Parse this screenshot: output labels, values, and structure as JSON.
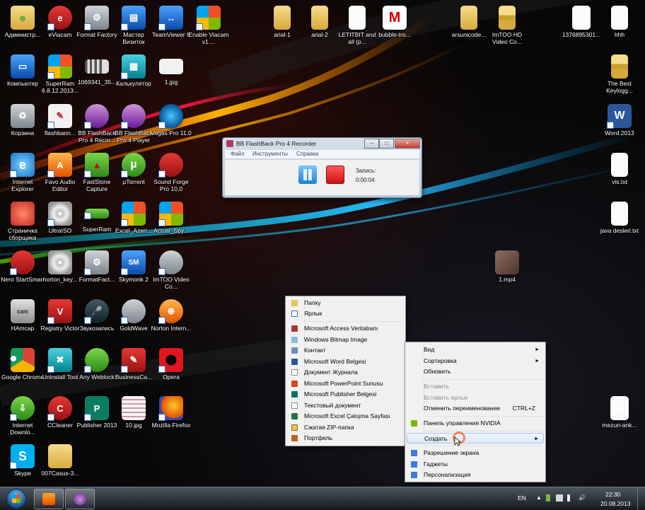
{
  "desktop": {
    "icons": [
      {
        "label": "Администр...",
        "icon": "user-folder-icon"
      },
      {
        "label": "eViacam",
        "icon": "eviacam-icon"
      },
      {
        "label": "Format Factory",
        "icon": "format-factory-icon"
      },
      {
        "label": "Мастер Визиток",
        "icon": "business-card-icon"
      },
      {
        "label": "TeamViewer 8",
        "icon": "teamviewer-icon"
      },
      {
        "label": "Enable Viacam v1....",
        "icon": "windows-installer-icon"
      },
      {
        "label": "arial-1",
        "icon": "folder-icon"
      },
      {
        "label": "arial-2",
        "icon": "folder-icon"
      },
      {
        "label": "LETITBIT and all (p...",
        "icon": "document-icon"
      },
      {
        "label": "bubble-tro...",
        "icon": "bubble-trouble-icon"
      },
      {
        "label": "arsunicode...",
        "icon": "folder-icon"
      },
      {
        "label": "ImTOO HD Video Co...",
        "icon": "archive-folder-icon"
      },
      {
        "label": "1376895301...",
        "icon": "word-document-icon"
      },
      {
        "label": "hhh",
        "icon": "document-icon"
      },
      {
        "label": "Компьютер",
        "icon": "computer-icon"
      },
      {
        "label": "SuperRam 6.8.12.2013...",
        "icon": "windows-installer-icon"
      },
      {
        "label": "1069341_35...",
        "icon": "image-icon"
      },
      {
        "label": "Калькулятор",
        "icon": "calculator-icon"
      },
      {
        "label": "1.jpg",
        "icon": "image-icon"
      },
      {
        "label": "The Best Keylogg...",
        "icon": "archive-folder-icon"
      },
      {
        "label": "Корзина",
        "icon": "recycle-bin-icon"
      },
      {
        "label": "flashbann...",
        "icon": "flash-banner-icon"
      },
      {
        "label": "BB FlashBack Pro 4 Recor...",
        "icon": "flashback-recorder-icon"
      },
      {
        "label": "BB FlashBack Pro 4 Player",
        "icon": "flashback-player-icon"
      },
      {
        "label": "Vegas Pro 11.0",
        "icon": "vegas-pro-icon"
      },
      {
        "label": "Word 2013",
        "icon": "word-icon"
      },
      {
        "label": "Internet Explorer",
        "icon": "internet-explorer-icon"
      },
      {
        "label": "Favo Audio Editor",
        "icon": "audio-editor-icon"
      },
      {
        "label": "FastStone Capture",
        "icon": "faststone-capture-icon"
      },
      {
        "label": "µTorrent",
        "icon": "utorrent-icon"
      },
      {
        "label": "Sound Forge Pro 10.0",
        "icon": "sound-forge-icon"
      },
      {
        "label": "vis.txt",
        "icon": "text-file-icon"
      },
      {
        "label": "Страничка сборщика",
        "icon": "collector-page-icon"
      },
      {
        "label": "UltraISO",
        "icon": "ultraiso-icon"
      },
      {
        "label": "SuperRam",
        "icon": "superram-icon"
      },
      {
        "label": "Excel_Azeri...",
        "icon": "windows-installer-icon"
      },
      {
        "label": "Actual_Spy...",
        "icon": "windows-installer-icon"
      },
      {
        "label": "java desleri.txt",
        "icon": "text-file-icon"
      },
      {
        "label": "Nero StartSmart",
        "icon": "nero-icon"
      },
      {
        "label": "norton_key...",
        "icon": "disc-icon"
      },
      {
        "label": "FormatFact...",
        "icon": "format-factory-icon"
      },
      {
        "label": "Skymonk 2",
        "icon": "skymonk-icon"
      },
      {
        "label": "ImTOO Video Co...",
        "icon": "film-reel-icon"
      },
      {
        "label": "1.mp4",
        "icon": "video-file-icon"
      },
      {
        "label": "HAmcap",
        "icon": "amcap-icon"
      },
      {
        "label": "Registry Victor",
        "icon": "registry-victor-icon"
      },
      {
        "label": "Звукозапись",
        "icon": "microphone-icon"
      },
      {
        "label": "GoldWave",
        "icon": "goldwave-icon"
      },
      {
        "label": "Norton Intern...",
        "icon": "norton-icon"
      },
      {
        "label": "Google Chrome",
        "icon": "chrome-icon"
      },
      {
        "label": "Uninstall Tool",
        "icon": "uninstall-tool-icon"
      },
      {
        "label": "Any Weblock",
        "icon": "any-weblock-icon"
      },
      {
        "label": "BusinessCa...",
        "icon": "business-card-icon"
      },
      {
        "label": "Opera",
        "icon": "opera-icon"
      },
      {
        "label": "Internet Downlo...",
        "icon": "internet-download-manager-icon"
      },
      {
        "label": "CCleaner",
        "icon": "ccleaner-icon"
      },
      {
        "label": "Publisher 2013",
        "icon": "publisher-icon"
      },
      {
        "label": "10.jpg",
        "icon": "image-icon"
      },
      {
        "label": "Mozilla Firefox",
        "icon": "firefox-icon"
      },
      {
        "label": "mezun-ank...",
        "icon": "word-document-icon"
      },
      {
        "label": "Skype",
        "icon": "skype-icon"
      },
      {
        "label": "007Casus-3...",
        "icon": "folder-icon"
      }
    ]
  },
  "recorder": {
    "title": "BB FlashBack Pro 4 Recorder",
    "menu": [
      "Файл",
      "Инструменты",
      "Справка"
    ],
    "record_label": "Запись:",
    "record_time": "0:00:04",
    "minimize": "–",
    "maximize": "□",
    "close": "×"
  },
  "create_submenu": {
    "items": [
      {
        "label": "Папку",
        "icon": "folder-icon"
      },
      {
        "label": "Ярлык",
        "icon": "shortcut-icon"
      },
      {
        "label": "Microsoft Access Veritabanı",
        "icon": "access-icon"
      },
      {
        "label": "Windows Bitmap Image",
        "icon": "bitmap-icon"
      },
      {
        "label": "Контакт",
        "icon": "contact-icon"
      },
      {
        "label": "Microsoft Word Belgesi",
        "icon": "word-icon"
      },
      {
        "label": "Документ Журнала",
        "icon": "journal-icon"
      },
      {
        "label": "Microsoft PowerPoint Sunusu",
        "icon": "powerpoint-icon"
      },
      {
        "label": "Microsoft Publisher Belgesi",
        "icon": "publisher-icon"
      },
      {
        "label": "Текстовый документ",
        "icon": "text-document-icon"
      },
      {
        "label": "Microsoft Excel Çalışma Sayfası",
        "icon": "excel-icon"
      },
      {
        "label": "Сжатая ZIP-папка",
        "icon": "zip-folder-icon"
      },
      {
        "label": "Портфель",
        "icon": "briefcase-icon"
      }
    ]
  },
  "context_menu": {
    "view": "Вид",
    "sort": "Сортировка",
    "refresh": "Обновить",
    "paste": "Вставить",
    "paste_shortcut": "Вставить ярлык",
    "undo_rename": "Отменить переименование",
    "undo_shortcut": "CTRL+Z",
    "nvidia": "Панель управления NVIDIA",
    "create": "Создать",
    "resolution": "Разрешение экрана",
    "gadgets": "Гаджеты",
    "personalize": "Персонализация",
    "submenu_arrow": "►"
  },
  "taskbar": {
    "lang": "EN",
    "time": "22:30",
    "date": "20.08.2013",
    "tray_expand": "▲"
  },
  "colors": {
    "accent_red": "#e0161e",
    "menu_bg": "#f0f0f0",
    "highlight": "#dae7f5"
  }
}
